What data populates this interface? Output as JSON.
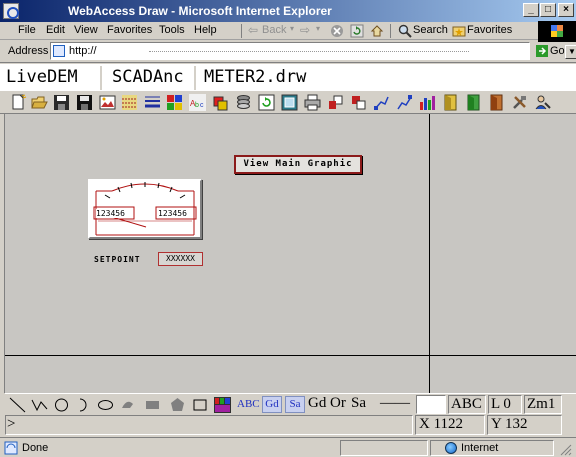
{
  "window": {
    "title": "WebAccess Draw - Microsoft Internet Explorer",
    "controls": {
      "minimize": "_",
      "maximize": "□",
      "close": "×"
    }
  },
  "menu": [
    "File",
    "Edit",
    "View",
    "Favorites",
    "Tools",
    "Help"
  ],
  "nav": {
    "back": "Back",
    "search": "Search",
    "favorites": "Favorites"
  },
  "address": {
    "label": "Address",
    "url": "http://",
    "go": "Go"
  },
  "doc_tabs": [
    "LiveDEM",
    "SCADAnc",
    "METER2.drw"
  ],
  "canvas": {
    "view_button": "View Main Graphic",
    "meter_left_digits": "123456",
    "meter_right_digits": "123456",
    "setpoint_label": "SETPOINT",
    "setpoint_value": "XXXXXX"
  },
  "draw_toolbar": {
    "abc_blue": "ABC",
    "gd_blue": "Gd",
    "sa_blue": "Sa",
    "gd": "Gd",
    "or": "Or",
    "sa": "Sa",
    "line_style": "——",
    "abc": "ABC",
    "layer": "L 0",
    "zoom": "Zm1"
  },
  "command": {
    "prompt": ">",
    "x": "X 1122",
    "y": "Y  132"
  },
  "status": {
    "text": "Done",
    "zone": "Internet"
  },
  "colors": {
    "title_start": "#0a246a",
    "title_end": "#a6caf0",
    "canvas_bg": "#c8c6c2",
    "meter_red": "#b01010"
  }
}
